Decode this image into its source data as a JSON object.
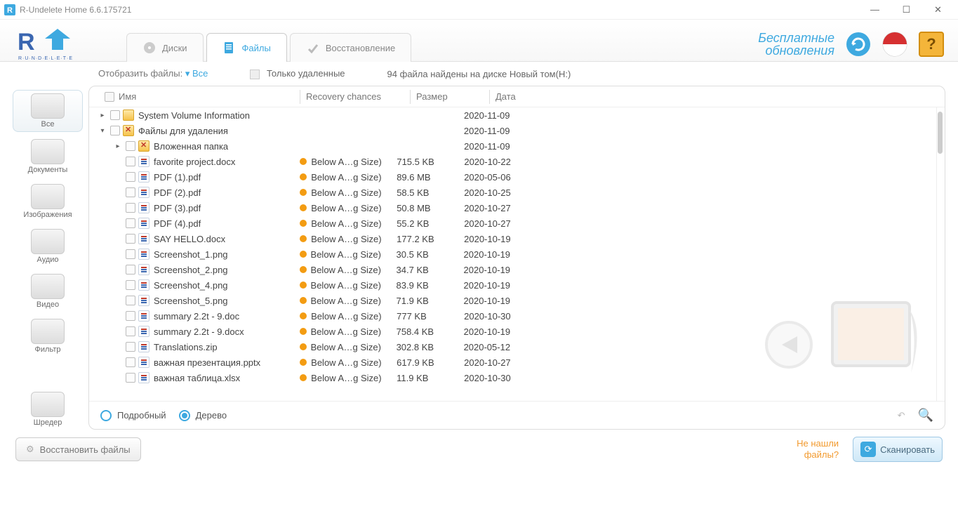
{
  "window": {
    "title": "R-Undelete Home 6.6.175721"
  },
  "tabs": {
    "disks": "Диски",
    "files": "Файлы",
    "recovery": "Восстановление",
    "active_index": 1
  },
  "top_right": {
    "updates_line1": "Бесплатные",
    "updates_line2": "обновления",
    "help_glyph": "?"
  },
  "filterbar": {
    "show_files_label": "Отобразить файлы:",
    "show_files_value": "Все",
    "only_deleted_label": "Только удаленные",
    "status": "94 файла найдены на диске Новый том(H:)"
  },
  "leftrail": [
    {
      "key": "all",
      "label": "Все",
      "active": true
    },
    {
      "key": "docs",
      "label": "Документы"
    },
    {
      "key": "images",
      "label": "Изображения"
    },
    {
      "key": "audio",
      "label": "Аудио"
    },
    {
      "key": "video",
      "label": "Видео"
    },
    {
      "key": "filter",
      "label": "Фильтр"
    }
  ],
  "shredder_label": "Шредер",
  "columns": {
    "name": "Имя",
    "recovery": "Recovery chances",
    "size": "Размер",
    "date": "Дата"
  },
  "recovery_text": "Below A…g Size)",
  "rows": [
    {
      "indent": 0,
      "exp": "▸",
      "icon": "folder",
      "name": "System Volume Information",
      "rec": "",
      "size": "",
      "date": "2020-11-09"
    },
    {
      "indent": 0,
      "exp": "▾",
      "icon": "folderx",
      "name": "Файлы для удаления",
      "rec": "",
      "size": "",
      "date": "2020-11-09"
    },
    {
      "indent": 1,
      "exp": "▸",
      "icon": "folderx",
      "name": "Вложенная папка",
      "rec": "",
      "size": "",
      "date": "2020-11-09"
    },
    {
      "indent": 1,
      "exp": "",
      "icon": "file",
      "name": "favorite project.docx",
      "rec": "dot",
      "size": "715.5 KB",
      "date": "2020-10-22"
    },
    {
      "indent": 1,
      "exp": "",
      "icon": "file",
      "name": "PDF (1).pdf",
      "rec": "dot",
      "size": "89.6 MB",
      "date": "2020-05-06"
    },
    {
      "indent": 1,
      "exp": "",
      "icon": "file",
      "name": "PDF (2).pdf",
      "rec": "dot",
      "size": "58.5 KB",
      "date": "2020-10-25"
    },
    {
      "indent": 1,
      "exp": "",
      "icon": "file",
      "name": "PDF (3).pdf",
      "rec": "dot",
      "size": "50.8 MB",
      "date": "2020-10-27"
    },
    {
      "indent": 1,
      "exp": "",
      "icon": "file",
      "name": "PDF (4).pdf",
      "rec": "dot",
      "size": "55.2 KB",
      "date": "2020-10-27"
    },
    {
      "indent": 1,
      "exp": "",
      "icon": "file",
      "name": "SAY HELLO.docx",
      "rec": "dot",
      "size": "177.2 KB",
      "date": "2020-10-19"
    },
    {
      "indent": 1,
      "exp": "",
      "icon": "file",
      "name": "Screenshot_1.png",
      "rec": "dot",
      "size": "30.5 KB",
      "date": "2020-10-19"
    },
    {
      "indent": 1,
      "exp": "",
      "icon": "file",
      "name": "Screenshot_2.png",
      "rec": "dot",
      "size": "34.7 KB",
      "date": "2020-10-19"
    },
    {
      "indent": 1,
      "exp": "",
      "icon": "file",
      "name": "Screenshot_4.png",
      "rec": "dot",
      "size": "83.9 KB",
      "date": "2020-10-19"
    },
    {
      "indent": 1,
      "exp": "",
      "icon": "file",
      "name": "Screenshot_5.png",
      "rec": "dot",
      "size": "71.9 KB",
      "date": "2020-10-19"
    },
    {
      "indent": 1,
      "exp": "",
      "icon": "file",
      "name": "summary 2.2t - 9.doc",
      "rec": "dot",
      "size": "777 KB",
      "date": "2020-10-30"
    },
    {
      "indent": 1,
      "exp": "",
      "icon": "file",
      "name": "summary 2.2t - 9.docx",
      "rec": "dot",
      "size": "758.4 KB",
      "date": "2020-10-19"
    },
    {
      "indent": 1,
      "exp": "",
      "icon": "file",
      "name": "Translations.zip",
      "rec": "dot",
      "size": "302.8 KB",
      "date": "2020-05-12"
    },
    {
      "indent": 1,
      "exp": "",
      "icon": "file",
      "name": "важная презентация.pptx",
      "rec": "dot",
      "size": "617.9 KB",
      "date": "2020-10-27"
    },
    {
      "indent": 1,
      "exp": "",
      "icon": "file",
      "name": "важная таблица.xlsx",
      "rec": "dot",
      "size": "11.9 KB",
      "date": "2020-10-30"
    }
  ],
  "viewbar": {
    "detailed": "Подробный",
    "tree": "Дерево",
    "selected": "tree"
  },
  "bottombar": {
    "recover": "Восстановить файлы",
    "not_found_q": "Не нашли файлы?",
    "scan": "Сканировать"
  }
}
